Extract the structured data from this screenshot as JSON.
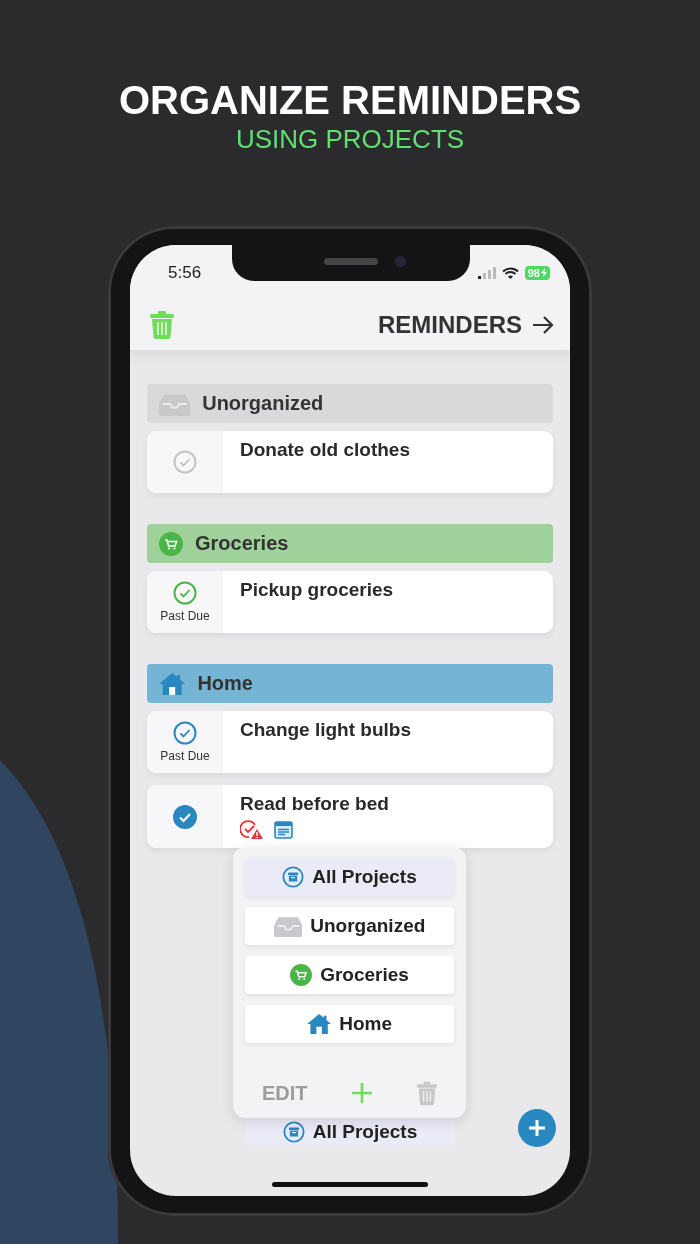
{
  "headline": {
    "title": "ORGANIZE REMINDERS",
    "subtitle": "USING PROJECTS"
  },
  "status_bar": {
    "time": "5:56",
    "battery": "98"
  },
  "nav": {
    "title": "REMINDERS"
  },
  "groups": [
    {
      "name": "Unorganized",
      "kind": "inbox",
      "color": "#d9d9db",
      "items": [
        {
          "title": "Donate old clothes",
          "completed": false
        }
      ]
    },
    {
      "name": "Groceries",
      "kind": "cart",
      "color": "#9fd19a",
      "items": [
        {
          "title": "Pickup groceries",
          "completed": false,
          "status": "Past Due"
        }
      ]
    },
    {
      "name": "Home",
      "kind": "house",
      "color": "#75b4d4",
      "items": [
        {
          "title": "Change light bulbs",
          "completed": false,
          "status": "Past Due"
        },
        {
          "title": "Read before bed",
          "completed": true,
          "indicators": [
            {
              "kind": "alert"
            },
            {
              "kind": "note"
            }
          ]
        }
      ]
    }
  ],
  "project_menu": {
    "items": [
      {
        "label": "All Projects",
        "kind": "all",
        "selected": true
      },
      {
        "label": "Unorganized",
        "kind": "inbox",
        "selected": false
      },
      {
        "label": "Groceries",
        "kind": "cart",
        "selected": false
      },
      {
        "label": "Home",
        "kind": "house",
        "selected": false
      }
    ],
    "edit": "EDIT"
  },
  "project_picker": {
    "label": "All Projects",
    "kind": "all"
  }
}
